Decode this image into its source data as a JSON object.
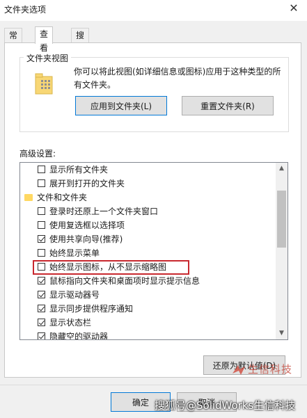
{
  "window": {
    "title": "文件夹选项",
    "close_glyph": "✕"
  },
  "tabs": [
    {
      "label": "常规",
      "active": false
    },
    {
      "label": "查看",
      "active": true
    },
    {
      "label": "搜索",
      "active": false
    }
  ],
  "folder_views": {
    "group_title": "文件夹视图",
    "description": "你可以将此视图(如详细信息或图标)应用于这种类型的所有文件夹。",
    "apply_button": "应用到文件夹(L)",
    "reset_button": "重置文件夹(R)"
  },
  "advanced": {
    "label": "高级设置:",
    "items": [
      {
        "type": "checkbox",
        "label": "显示所有文件夹",
        "checked": false,
        "highlighted": false
      },
      {
        "type": "checkbox",
        "label": "展开到打开的文件夹",
        "checked": false,
        "highlighted": false
      },
      {
        "type": "folder",
        "label": "文件和文件夹"
      },
      {
        "type": "checkbox",
        "label": "登录时还原上一个文件夹窗口",
        "checked": false,
        "highlighted": false
      },
      {
        "type": "checkbox",
        "label": "使用复选框以选择项",
        "checked": false,
        "highlighted": false
      },
      {
        "type": "checkbox",
        "label": "使用共享向导(推荐)",
        "checked": true,
        "highlighted": false
      },
      {
        "type": "checkbox",
        "label": "始终显示菜单",
        "checked": false,
        "highlighted": false
      },
      {
        "type": "checkbox",
        "label": "始终显示图标，从不显示缩略图",
        "checked": false,
        "highlighted": true
      },
      {
        "type": "checkbox",
        "label": "鼠标指向文件夹和桌面项时显示提示信息",
        "checked": true,
        "highlighted": false
      },
      {
        "type": "checkbox",
        "label": "显示驱动器号",
        "checked": true,
        "highlighted": false
      },
      {
        "type": "checkbox",
        "label": "显示同步提供程序通知",
        "checked": true,
        "highlighted": false
      },
      {
        "type": "checkbox",
        "label": "显示状态栏",
        "checked": true,
        "highlighted": false
      },
      {
        "type": "checkbox",
        "label": "隐藏空的驱动器",
        "checked": true,
        "highlighted": false
      }
    ],
    "restore_defaults_button": "还原为默认值(D)"
  },
  "footer": {
    "ok_button": "确定",
    "cancel_button": "取消"
  },
  "watermarks": {
    "brand_text": "生信科技",
    "bottom_text": "搜狐号@SolidWorks生信科技"
  },
  "colors": {
    "highlight_border": "#c8282e",
    "default_button_border": "#0078d7",
    "folder_yellow": "#ffd862"
  }
}
